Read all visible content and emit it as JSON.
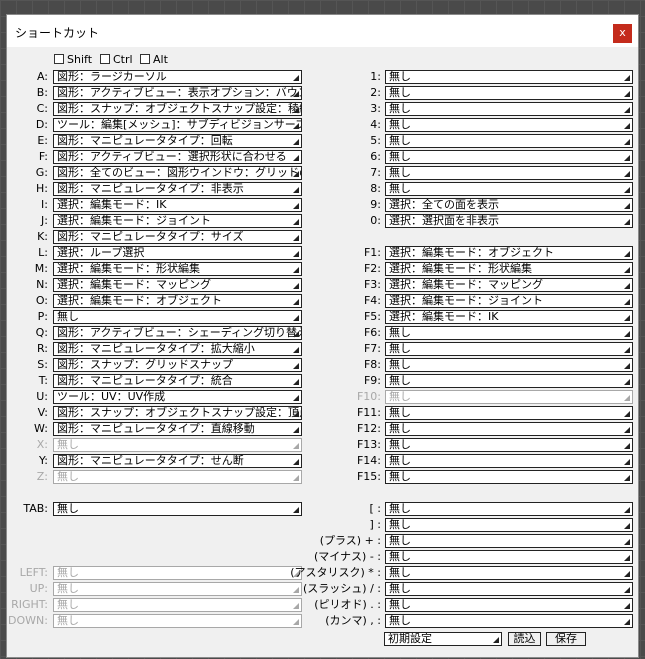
{
  "window": {
    "title": "ショートカット",
    "close_label": "x"
  },
  "modifiers": [
    {
      "label": "Shift",
      "checked": false
    },
    {
      "label": "Ctrl",
      "checked": false
    },
    {
      "label": "Alt",
      "checked": false
    }
  ],
  "left_rows": [
    {
      "key": "A:",
      "value": "図形：ラージカーソル",
      "disabled": false
    },
    {
      "key": "B:",
      "value": "図形：アクティブビュー：表示オプション：バウン",
      "disabled": false
    },
    {
      "key": "C:",
      "value": "図形：スナップ：オブジェクトスナップ設定：稜線",
      "disabled": false
    },
    {
      "key": "D:",
      "value": "ツール：編集[メッシュ]：サブディビジョンサーフェス",
      "disabled": false
    },
    {
      "key": "E:",
      "value": "図形：マニピュレータタイプ：回転",
      "disabled": false
    },
    {
      "key": "F:",
      "value": "図形：アクティブビュー：選択形状に合わせる",
      "disabled": false
    },
    {
      "key": "G:",
      "value": "図形：全てのビュー：図形ウインドウ：グリッドの",
      "disabled": false
    },
    {
      "key": "H:",
      "value": "図形：マニピュレータタイプ：非表示",
      "disabled": false
    },
    {
      "key": "I:",
      "value": "選択：編集モード：IK",
      "disabled": false
    },
    {
      "key": "J:",
      "value": "選択：編集モード：ジョイント",
      "disabled": false
    },
    {
      "key": "K:",
      "value": "図形：マニピュレータタイプ：サイズ",
      "disabled": false
    },
    {
      "key": "L:",
      "value": "選択：ループ選択",
      "disabled": false
    },
    {
      "key": "M:",
      "value": "選択：編集モード：形状編集",
      "disabled": false
    },
    {
      "key": "N:",
      "value": "選択：編集モード：マッピング",
      "disabled": false
    },
    {
      "key": "O:",
      "value": "選択：編集モード：オブジェクト",
      "disabled": false
    },
    {
      "key": "P:",
      "value": "無し",
      "disabled": false
    },
    {
      "key": "Q:",
      "value": "図形：アクティブビュー：シェーディング切り替え",
      "disabled": false
    },
    {
      "key": "R:",
      "value": "図形：マニピュレータタイプ：拡大縮小",
      "disabled": false
    },
    {
      "key": "S:",
      "value": "図形：スナップ：グリッドスナップ",
      "disabled": false
    },
    {
      "key": "T:",
      "value": "図形：マニピュレータタイプ：統合",
      "disabled": false
    },
    {
      "key": "U:",
      "value": "ツール：UV：UV作成",
      "disabled": false
    },
    {
      "key": "V:",
      "value": "図形：スナップ：オブジェクトスナップ設定：頂点",
      "disabled": false
    },
    {
      "key": "W:",
      "value": "図形：マニピュレータタイプ：直線移動",
      "disabled": false
    },
    {
      "key": "X:",
      "value": "無し",
      "disabled": true
    },
    {
      "key": "Y:",
      "value": "図形：マニピュレータタイプ：せん断",
      "disabled": false
    },
    {
      "key": "Z:",
      "value": "無し",
      "disabled": true
    }
  ],
  "right_rows": [
    {
      "key": "1:",
      "value": "無し",
      "disabled": false
    },
    {
      "key": "2:",
      "value": "無し",
      "disabled": false
    },
    {
      "key": "3:",
      "value": "無し",
      "disabled": false
    },
    {
      "key": "4:",
      "value": "無し",
      "disabled": false
    },
    {
      "key": "5:",
      "value": "無し",
      "disabled": false
    },
    {
      "key": "6:",
      "value": "無し",
      "disabled": false
    },
    {
      "key": "7:",
      "value": "無し",
      "disabled": false
    },
    {
      "key": "8:",
      "value": "無し",
      "disabled": false
    },
    {
      "key": "9:",
      "value": "選択：全ての面を表示",
      "disabled": false
    },
    {
      "key": "0:",
      "value": "選択：選択面を非表示",
      "disabled": false
    },
    {
      "key": "",
      "value": "",
      "disabled": false,
      "empty": true
    },
    {
      "key": "F1:",
      "value": "選択：編集モード：オブジェクト",
      "disabled": false
    },
    {
      "key": "F2:",
      "value": "選択：編集モード：形状編集",
      "disabled": false
    },
    {
      "key": "F3:",
      "value": "選択：編集モード：マッピング",
      "disabled": false
    },
    {
      "key": "F4:",
      "value": "選択：編集モード：ジョイント",
      "disabled": false
    },
    {
      "key": "F5:",
      "value": "選択：編集モード：IK",
      "disabled": false
    },
    {
      "key": "F6:",
      "value": "無し",
      "disabled": false
    },
    {
      "key": "F7:",
      "value": "無し",
      "disabled": false
    },
    {
      "key": "F8:",
      "value": "無し",
      "disabled": false
    },
    {
      "key": "F9:",
      "value": "無し",
      "disabled": false
    },
    {
      "key": "F10:",
      "value": "無し",
      "disabled": true
    },
    {
      "key": "F11:",
      "value": "無し",
      "disabled": false
    },
    {
      "key": "F12:",
      "value": "無し",
      "disabled": false
    },
    {
      "key": "F13:",
      "value": "無し",
      "disabled": false
    },
    {
      "key": "F14:",
      "value": "無し",
      "disabled": false
    },
    {
      "key": "F15:",
      "value": "無し",
      "disabled": false
    }
  ],
  "tab_row": {
    "key": "TAB:",
    "value": "無し",
    "disabled": false
  },
  "arrow_rows": [
    {
      "key": "LEFT:",
      "value": "無し",
      "disabled": true
    },
    {
      "key": "UP:",
      "value": "無し",
      "disabled": true
    },
    {
      "key": "RIGHT:",
      "value": "無し",
      "disabled": true
    },
    {
      "key": "DOWN:",
      "value": "無し",
      "disabled": true
    }
  ],
  "symbol_rows": [
    {
      "key": "[ :",
      "value": "無し",
      "disabled": false
    },
    {
      "key": "] :",
      "value": "無し",
      "disabled": false
    },
    {
      "key": "(プラス) + :",
      "value": "無し",
      "disabled": false
    },
    {
      "key": "(マイナス) - :",
      "value": "無し",
      "disabled": false
    },
    {
      "key": "(アスタリスク) * :",
      "value": "無し",
      "disabled": false
    },
    {
      "key": "(スラッシュ) / :",
      "value": "無し",
      "disabled": false
    },
    {
      "key": "(ピリオド) . :",
      "value": "無し",
      "disabled": false
    },
    {
      "key": "(カンマ) , :",
      "value": "無し",
      "disabled": false
    }
  ],
  "footer": {
    "preset_value": "初期設定",
    "load_label": "読込",
    "save_label": "保存"
  }
}
